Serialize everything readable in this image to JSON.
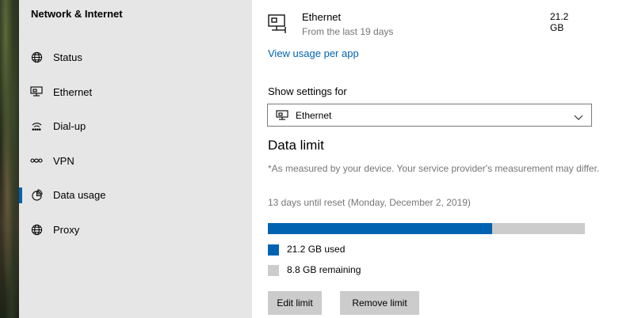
{
  "sidebar": {
    "title": "Network & Internet",
    "items": [
      {
        "label": "Status",
        "icon": "globe-icon"
      },
      {
        "label": "Ethernet",
        "icon": "ethernet-icon"
      },
      {
        "label": "Dial-up",
        "icon": "dialup-icon"
      },
      {
        "label": "VPN",
        "icon": "vpn-icon"
      },
      {
        "label": "Data usage",
        "icon": "data-usage-icon",
        "selected": true
      },
      {
        "label": "Proxy",
        "icon": "globe-icon"
      }
    ]
  },
  "overview": {
    "name": "Ethernet",
    "period": "From the last 19 days",
    "amount": "21.2 GB"
  },
  "usage_link": "View usage per app",
  "settings": {
    "label": "Show settings for",
    "selected": "Ethernet"
  },
  "data_limit": {
    "heading": "Data limit",
    "note": "*As measured by your device. Your service provider's measurement may differ.",
    "reset": "13 days until reset (Monday, December 2, 2019)",
    "used_fraction": 0.707,
    "used_label": "21.2 GB used",
    "remaining_label": "8.8 GB remaining",
    "edit_button": "Edit limit",
    "remove_button": "Remove limit"
  },
  "colors": {
    "accent": "#0063b1",
    "remaining": "#cccccc",
    "sidebar_bg": "#e6e6e6"
  }
}
